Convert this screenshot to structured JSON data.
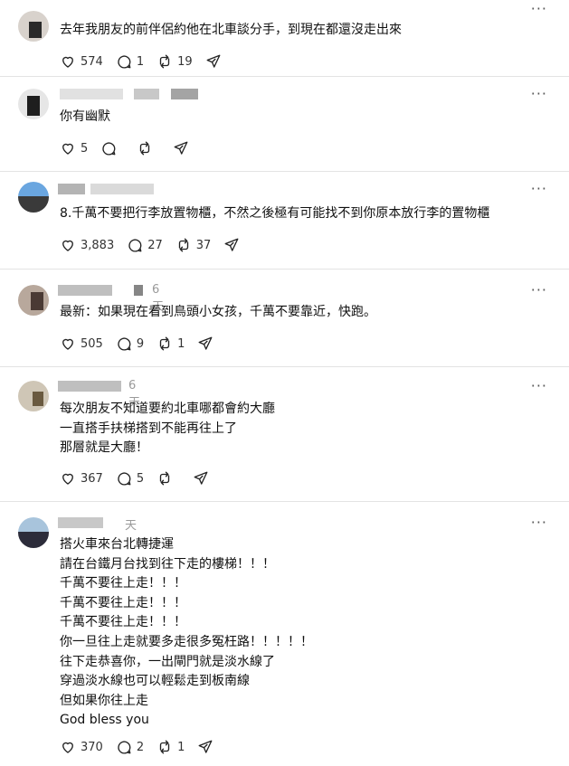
{
  "posts": [
    {
      "time": "",
      "text": "去年我朋友的前伴侶約他在北車談分手，到現在都還沒走出來",
      "likes": "574",
      "replies": "1",
      "reposts": "19"
    },
    {
      "time": "",
      "text": "你有幽默",
      "likes": "5",
      "replies": "",
      "reposts": ""
    },
    {
      "time": "",
      "text": "8.千萬不要把行李放置物櫃，不然之後極有可能找不到你原本放行李的置物櫃",
      "likes": "3,883",
      "replies": "27",
      "reposts": "37"
    },
    {
      "time": "6天",
      "text": "最新：如果現在看到鳥頭小女孩，千萬不要靠近，快跑。",
      "likes": "505",
      "replies": "9",
      "reposts": "1"
    },
    {
      "time": "6天",
      "text": "每次朋友不知道要約北車哪都會約大廳\n一直搭手扶梯搭到不能再往上了\n那層就是大廳！",
      "likes": "367",
      "replies": "5",
      "reposts": ""
    },
    {
      "time": "天",
      "text": "搭火車來台北轉捷運\n請在台鐵月台找到往下走的樓梯！！！\n千萬不要往上走！！！\n千萬不要往上走！！！\n千萬不要往上走！！！\n你一旦往上走就要多走很多冤枉路！！！！！\n往下走恭喜你，一出閘門就是淡水線了\n穿過淡水線也可以輕鬆走到板南線\n但如果你往上走\nGod bless you",
      "likes": "370",
      "replies": "2",
      "reposts": "1"
    }
  ],
  "icons": {
    "like": "heart-icon",
    "reply": "comment-icon",
    "repost": "repost-icon",
    "share": "send-icon",
    "more": "more-icon"
  },
  "more_glyph": "···"
}
